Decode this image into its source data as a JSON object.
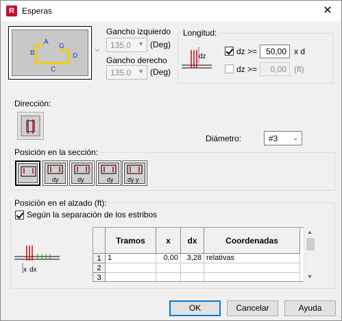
{
  "window": {
    "title": "Esperas",
    "app_icon_letter": "R",
    "close_glyph": "✕"
  },
  "hook_preview": {
    "labels": {
      "a": "A",
      "b": "B",
      "c": "C",
      "d": "D",
      "g": "G"
    }
  },
  "hooks": {
    "left_label": "Gancho izquierdo",
    "left_value": "135,0",
    "left_unit": "(Deg)",
    "right_label": "Gancho derecho",
    "right_value": "135,0",
    "right_unit": "(Deg)"
  },
  "length": {
    "group_title": "Longitud:",
    "icon_text": "dz",
    "row1": {
      "checked": true,
      "label": "dz >=",
      "value": "50,00",
      "unit": "x d"
    },
    "row2": {
      "checked": false,
      "label": "dz >=",
      "value": "0,00",
      "unit": "(ft)"
    }
  },
  "direction": {
    "label": "Dirección:"
  },
  "diameter": {
    "label": "Diámetro:",
    "value": "#3"
  },
  "section": {
    "group_title": "Posición en la sección:",
    "buttons": [
      {
        "sub": ""
      },
      {
        "sub": "dy"
      },
      {
        "sub": "dy"
      },
      {
        "sub": "dy"
      },
      {
        "sub": "dy y"
      }
    ]
  },
  "elevation": {
    "group_title": "Posición en el alzado (ft):",
    "checkbox_label": "Según la separación de los estribos",
    "checkbox_checked": true,
    "icon_labels": {
      "x": "x",
      "dx": "dx"
    },
    "table": {
      "headers": [
        "Tramos",
        "x",
        "dx",
        "Coordenadas"
      ],
      "rows": [
        {
          "n": "1",
          "tramos": "1",
          "x": "0,00",
          "dx": "3,28",
          "coord": "relativas"
        },
        {
          "n": "2",
          "tramos": "",
          "x": "",
          "dx": "",
          "coord": ""
        },
        {
          "n": "3",
          "tramos": "",
          "x": "",
          "dx": "",
          "coord": ""
        }
      ]
    }
  },
  "buttons": {
    "ok": "OK",
    "cancel": "Cancelar",
    "help": "Ayuda"
  },
  "colors": {
    "rebar_yellow": "#f0d000",
    "rebar_red": "#d00000",
    "label_blue": "#1f3fbf",
    "accent": "#0078d7"
  }
}
